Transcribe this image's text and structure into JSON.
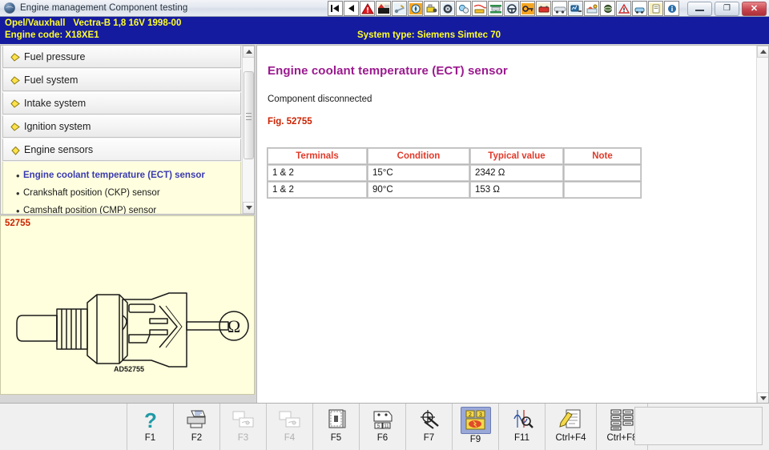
{
  "window": {
    "title": "Engine management Component testing",
    "icon": "globe-icon",
    "minimize_label": "",
    "restore_label": "❐",
    "close_label": "✕"
  },
  "vehicle_header": {
    "make": "Opel/Vauxhall",
    "model": "Vectra-B",
    "engine_spec": "1,8 16V 1998-00",
    "engine_code_label": "Engine code:",
    "engine_code": "X18XE1",
    "system_type_label": "System type:",
    "system_type": "Siemens Simtec 70",
    "bg_color": "#151b9e",
    "text_color": "#ffff2a"
  },
  "toolbar": {
    "buttons": [
      {
        "name": "first-record-icon",
        "glyph": "first"
      },
      {
        "name": "previous-record-icon",
        "glyph": "prev"
      },
      {
        "name": "warning-triangle-icon",
        "glyph": "warn"
      },
      {
        "name": "workshop-icon",
        "glyph": "workshop"
      },
      {
        "name": "tools-icon",
        "glyph": "tools"
      },
      {
        "name": "compass-icon",
        "glyph": "compass"
      },
      {
        "name": "engine-icon",
        "glyph": "engine"
      },
      {
        "name": "wheel-icon",
        "glyph": "wheel"
      },
      {
        "name": "brake-icon",
        "glyph": "brake"
      },
      {
        "name": "wiring-icon",
        "glyph": "wiring"
      },
      {
        "name": "lift-icon",
        "glyph": "lift"
      },
      {
        "name": "steering-icon",
        "glyph": "steering"
      },
      {
        "name": "key-icon",
        "glyph": "key"
      },
      {
        "name": "battery-icon",
        "glyph": "battery"
      },
      {
        "name": "ac-system-icon",
        "glyph": "ac"
      },
      {
        "name": "diagnostics-icon",
        "glyph": "diag"
      },
      {
        "name": "fluid-icon",
        "glyph": "fluid"
      },
      {
        "name": "body-repair-icon",
        "glyph": "body"
      },
      {
        "name": "tyre-icon",
        "glyph": "tyre"
      },
      {
        "name": "airbag-icon",
        "glyph": "airbag"
      },
      {
        "name": "service-icon",
        "glyph": "service"
      },
      {
        "name": "info-icon",
        "glyph": "info"
      }
    ]
  },
  "tree": {
    "groups": [
      {
        "label": "Fuel pressure",
        "expanded": false
      },
      {
        "label": "Fuel system",
        "expanded": false
      },
      {
        "label": "Intake system",
        "expanded": false
      },
      {
        "label": "Ignition system",
        "expanded": false
      },
      {
        "label": "Engine sensors",
        "expanded": true
      }
    ],
    "sub_items": [
      {
        "label": "Engine coolant temperature (ECT) sensor",
        "selected": true
      },
      {
        "label": "Crankshaft position (CKP) sensor",
        "selected": false
      },
      {
        "label": "Camshaft position (CMP) sensor",
        "selected": false
      }
    ]
  },
  "figure": {
    "number": "52755",
    "part_code": "AD52755",
    "caption_color": "#cc2200",
    "bg_color": "#ffffdd"
  },
  "content": {
    "title": "Engine coolant temperature (ECT) sensor",
    "condition_note": "Component disconnected",
    "figure_ref": "Fig. 52755",
    "title_color": "#9b1a8f",
    "table": {
      "headers": [
        "Terminals",
        "Condition",
        "Typical value",
        "Note"
      ],
      "rows": [
        [
          "1 & 2",
          "15°C",
          "2342 Ω",
          ""
        ],
        [
          "1 & 2",
          "90°C",
          "153 Ω",
          ""
        ]
      ]
    }
  },
  "function_keys": [
    {
      "key": "F1",
      "icon": "help-question-icon",
      "state": "enabled"
    },
    {
      "key": "F2",
      "icon": "print-icon",
      "state": "enabled"
    },
    {
      "key": "F3",
      "icon": "previous-image-icon",
      "state": "disabled"
    },
    {
      "key": "F4",
      "icon": "next-image-icon",
      "state": "disabled"
    },
    {
      "key": "F5",
      "icon": "component-location-icon",
      "state": "enabled"
    },
    {
      "key": "F6",
      "icon": "connector-pinout-icon",
      "state": "enabled"
    },
    {
      "key": "F7",
      "icon": "adjustment-icon",
      "state": "enabled"
    },
    {
      "key": "F9",
      "icon": "component-testing-icon",
      "state": "active"
    },
    {
      "key": "F11",
      "icon": "oscilloscope-icon",
      "state": "enabled"
    },
    {
      "key": "Ctrl+F4",
      "icon": "notes-icon",
      "state": "enabled"
    },
    {
      "key": "Ctrl+F8",
      "icon": "datasheet-icon",
      "state": "enabled"
    }
  ]
}
